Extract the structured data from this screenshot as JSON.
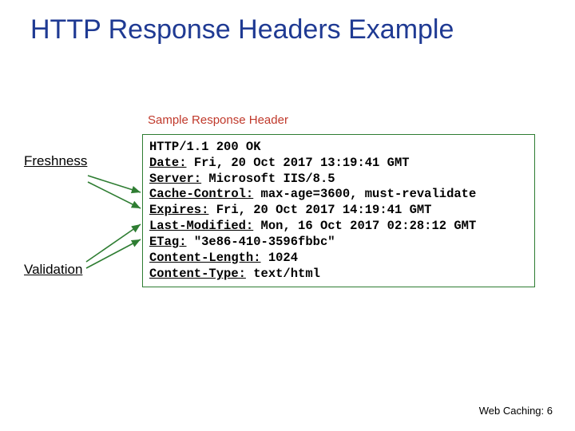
{
  "title": "HTTP Response Headers Example",
  "caption": "Sample Response Header",
  "labels": {
    "freshness": "Freshness",
    "validation": "Validation"
  },
  "code": {
    "l0": "HTTP/1.1 200 OK",
    "l1_k": "Date:",
    "l1_v": " Fri, 20 Oct 2017 13:19:41 GMT",
    "l2_k": "Server:",
    "l2_v": " Microsoft IIS/8.5",
    "l3_k": "Cache-Control:",
    "l3_v": " max-age=3600, must-revalidate",
    "l4_k": "Expires:",
    "l4_v": " Fri, 20 Oct 2017 14:19:41 GMT",
    "l5_k": "Last-Modified:",
    "l5_v": " Mon, 16 Oct 2017 02:28:12 GMT",
    "l6_k": "ETag:",
    "l6_v": " \"3e86-410-3596fbbc\"",
    "l7_k": "Content-Length:",
    "l7_v": " 1024",
    "l8_k": "Content-Type:",
    "l8_v": " text/html"
  },
  "footer": "Web Caching: 6"
}
